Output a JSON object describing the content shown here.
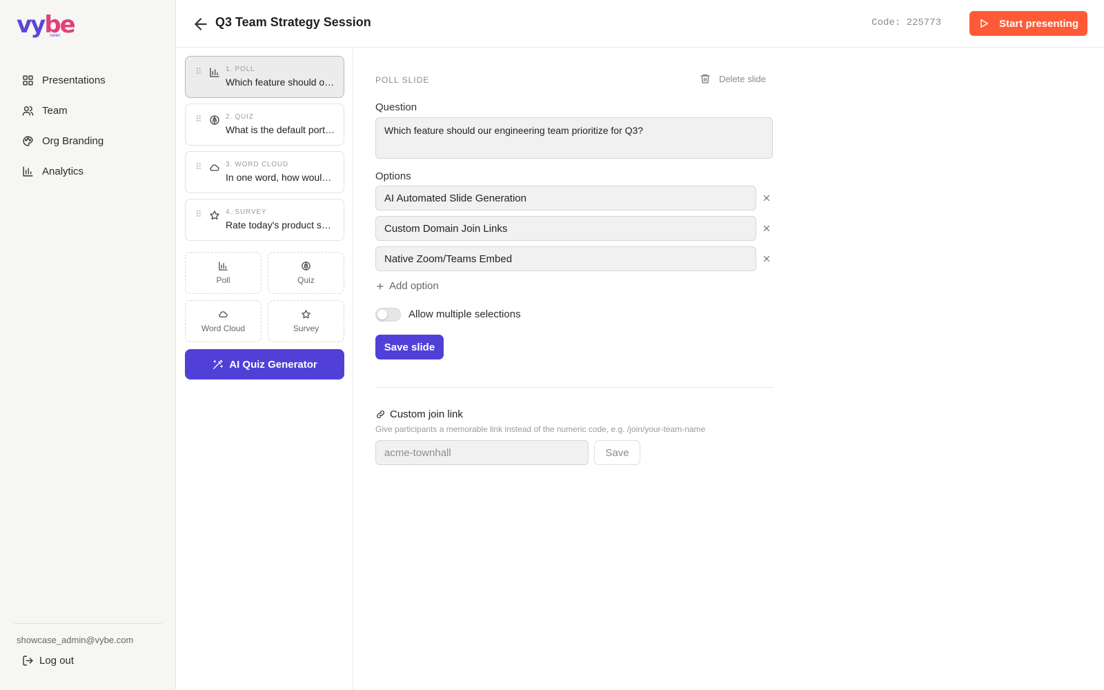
{
  "app": {
    "logo_text_a": "vy",
    "logo_text_b": "be",
    "logo_sub": "meter",
    "brand_colors": {
      "primary": "#5040d8",
      "accent": "#ff5a36",
      "logo_pink": "#e2407a"
    }
  },
  "sidebar": {
    "items": [
      {
        "label": "Presentations",
        "icon": "grid-icon"
      },
      {
        "label": "Team",
        "icon": "users-icon"
      },
      {
        "label": "Org Branding",
        "icon": "palette-icon"
      },
      {
        "label": "Analytics",
        "icon": "bar-chart-icon"
      }
    ],
    "user_email": "showcase_admin@vybe.com",
    "logout_label": "Log out"
  },
  "header": {
    "title": "Q3 Team Strategy Session",
    "code_text": "Code: 225773",
    "present_label": "Start presenting"
  },
  "slides": [
    {
      "type": "1. POLL",
      "question": "Which feature should our engineering team prioritize for Q3?",
      "icon": "bar-chart-icon",
      "active": true
    },
    {
      "type": "2. QUIZ",
      "question": "What is the default port for HTTPS?",
      "icon": "brain-icon",
      "active": false
    },
    {
      "type": "3. WORD CLOUD",
      "question": "In one word, how would you describe this quarter?",
      "icon": "cloud-icon",
      "active": false
    },
    {
      "type": "4. SURVEY",
      "question": "Rate today's product session",
      "icon": "star-icon",
      "active": false
    }
  ],
  "add_slide": {
    "poll": "Poll",
    "quiz": "Quiz",
    "word_cloud": "Word Cloud",
    "survey": "Survey"
  },
  "ai_button_label": "AI Quiz Generator",
  "editor": {
    "section_label": "POLL SLIDE",
    "delete_label": "Delete slide",
    "question_label": "Question",
    "question_value": "Which feature should our engineering team prioritize for Q3?",
    "options_label": "Options",
    "options": [
      "AI Automated Slide Generation",
      "Custom Domain Join Links",
      "Native Zoom/Teams Embed"
    ],
    "add_option_label": "Add option",
    "multi_select_label": "Allow multiple selections",
    "multi_select_on": false,
    "save_label": "Save slide"
  },
  "join_link": {
    "title": "Custom join link",
    "hint": "Give participants a memorable link instead of the numeric code, e.g. /join/your-team-name",
    "placeholder": "acme-townhall",
    "save_label": "Save"
  }
}
